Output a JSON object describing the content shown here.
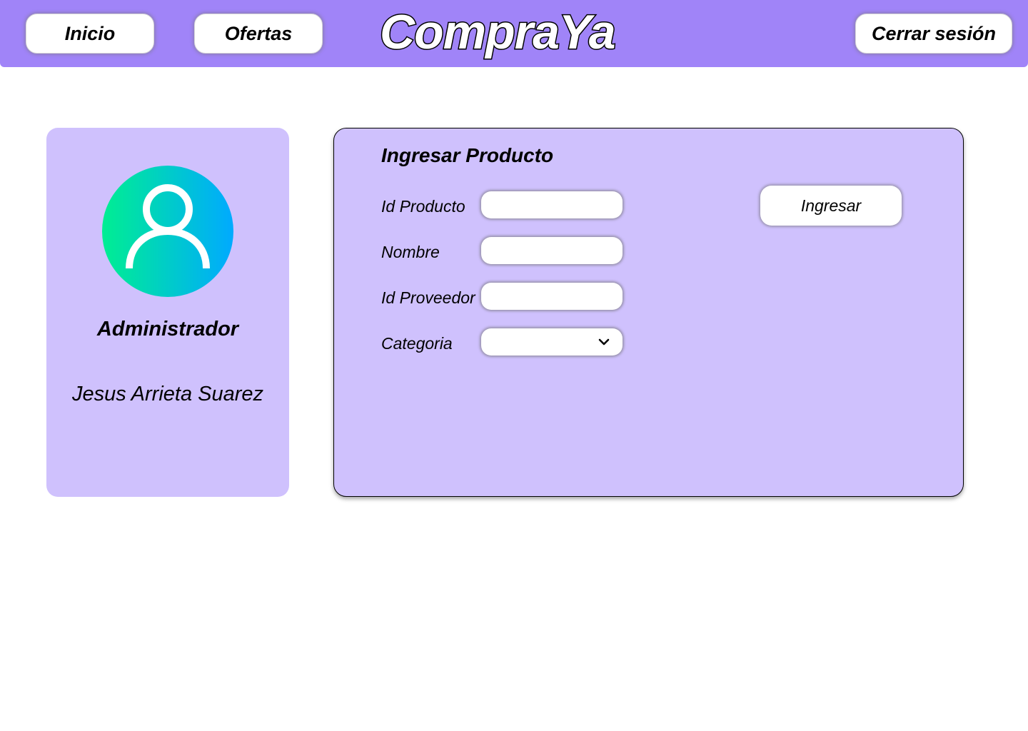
{
  "header": {
    "nav_inicio": "Inicio",
    "nav_ofertas": "Ofertas",
    "brand": "CompraYa",
    "logout": "Cerrar sesión",
    "bar_color": "#a084f8"
  },
  "profile": {
    "avatar_icon": "user-icon",
    "role": "Administrador",
    "name": "Jesus Arrieta Suarez",
    "card_color": "#cfc1fd"
  },
  "form": {
    "title": "Ingresar Producto",
    "fields": [
      {
        "label": "Id Producto",
        "value": ""
      },
      {
        "label": "Nombre",
        "value": ""
      },
      {
        "label": "Id Proveedor",
        "value": ""
      }
    ],
    "category": {
      "label": "Categoria",
      "selected": "",
      "icon": "chevron-down-icon"
    },
    "submit_label": "Ingresar"
  }
}
